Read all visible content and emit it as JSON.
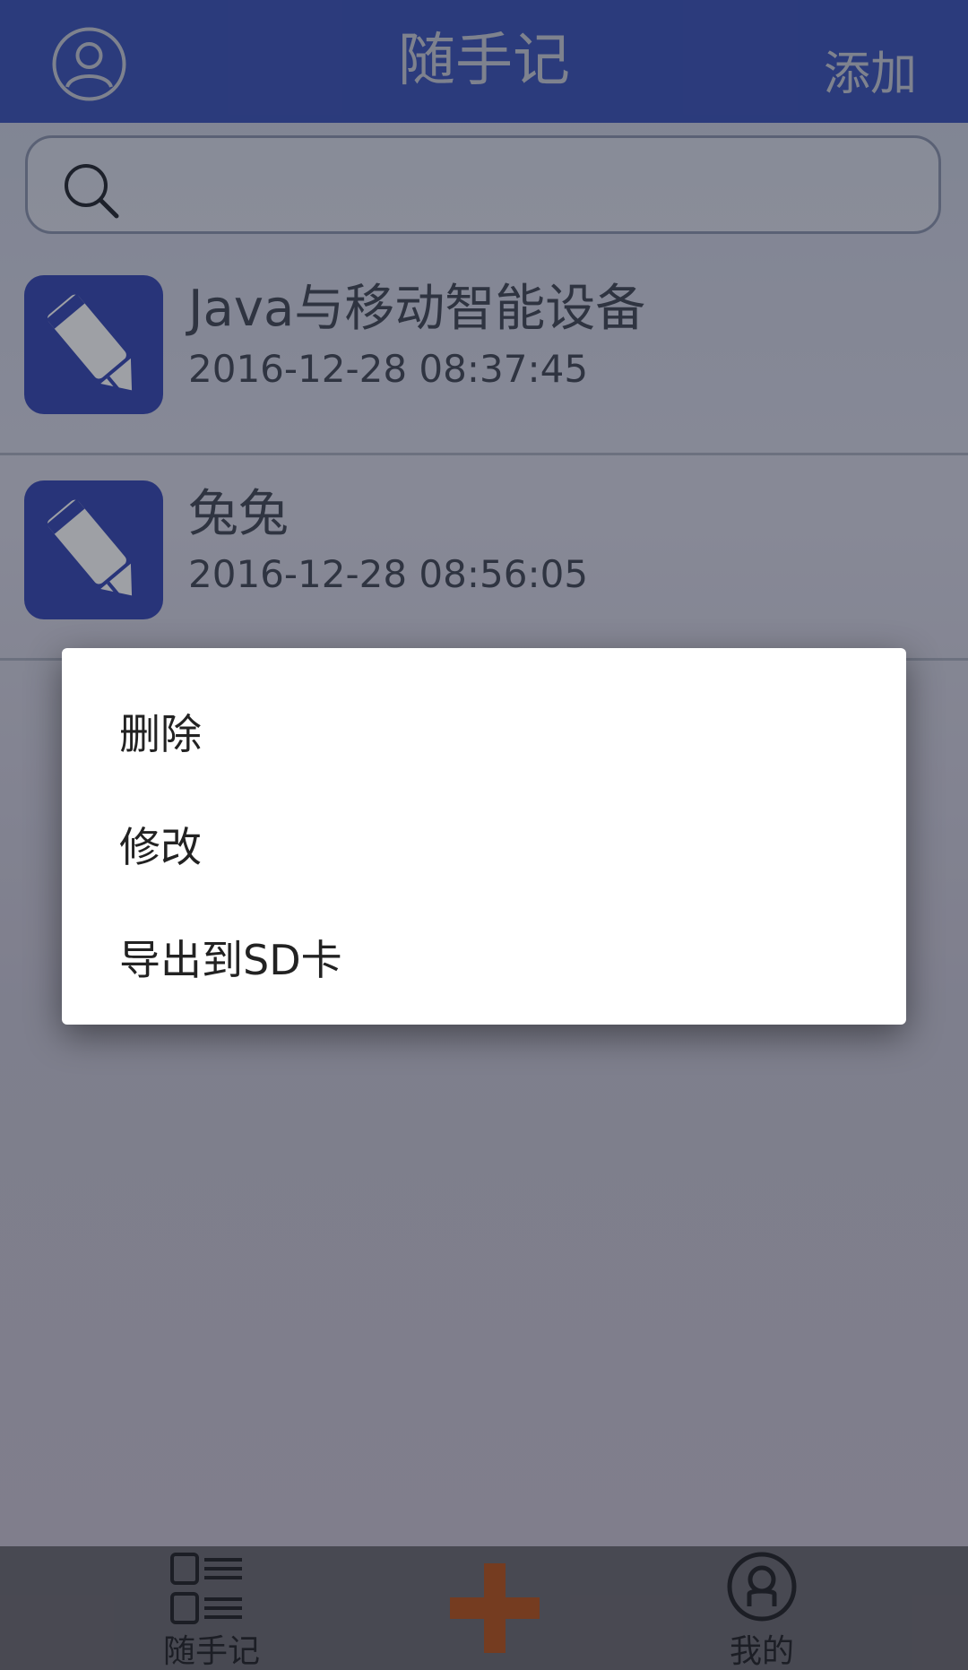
{
  "header": {
    "title": "随手记",
    "add_label": "添加",
    "avatar_icon": "user-circle-icon"
  },
  "search": {
    "icon": "search-icon",
    "placeholder": ""
  },
  "notes": [
    {
      "title": "Java与移动智能设备",
      "date": "2016-12-28 08:37:45",
      "icon": "pencil-icon"
    },
    {
      "title": "兔兔",
      "date": "2016-12-28 08:56:05",
      "icon": "pencil-icon"
    }
  ],
  "context_menu": {
    "items": [
      {
        "label": "删除"
      },
      {
        "label": "修改"
      },
      {
        "label": "导出到SD卡"
      }
    ]
  },
  "bottom_nav": {
    "notes_label": "随手记",
    "me_label": "我的",
    "notes_icon": "list-icon",
    "add_icon": "plus-icon",
    "me_icon": "user-circle-icon"
  },
  "colors": {
    "header_bg": "#3a51b8",
    "note_icon_bg": "#3546b3",
    "plus_color": "#b8541a"
  }
}
